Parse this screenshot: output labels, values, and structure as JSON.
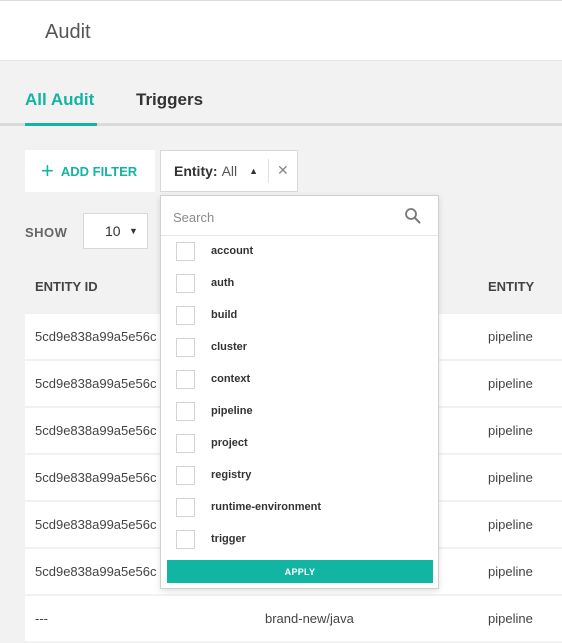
{
  "header": {
    "title": "Audit"
  },
  "tabs": [
    {
      "label": "All Audit",
      "active": true
    },
    {
      "label": "Triggers",
      "active": false
    }
  ],
  "toolbar": {
    "add_filter_label": "ADD FILTER",
    "entity_filter": {
      "label": "Entity:",
      "value": "All"
    }
  },
  "show": {
    "label": "SHOW",
    "value": "10"
  },
  "table": {
    "columns": [
      "ENTITY ID",
      "",
      "ENTITY"
    ],
    "rows": [
      {
        "entity_id": "5cd9e838a99a5e56c",
        "name": "",
        "entity": "pipeline"
      },
      {
        "entity_id": "5cd9e838a99a5e56c",
        "name": "",
        "entity": "pipeline"
      },
      {
        "entity_id": "5cd9e838a99a5e56c",
        "name": "",
        "entity": "pipeline"
      },
      {
        "entity_id": "5cd9e838a99a5e56c",
        "name": "",
        "entity": "pipeline"
      },
      {
        "entity_id": "5cd9e838a99a5e56c",
        "name": "",
        "entity": "pipeline"
      },
      {
        "entity_id": "5cd9e838a99a5e56c",
        "name": "",
        "entity": "pipeline"
      },
      {
        "entity_id": "---",
        "name": "brand-new/java",
        "entity": "pipeline"
      }
    ]
  },
  "dropdown": {
    "search_placeholder": "Search",
    "options": [
      "account",
      "auth",
      "build",
      "cluster",
      "context",
      "pipeline",
      "project",
      "registry",
      "runtime-environment",
      "trigger"
    ],
    "apply_label": "APPLY"
  },
  "colors": {
    "accent": "#12b5a2",
    "background": "#f2f2f2"
  }
}
